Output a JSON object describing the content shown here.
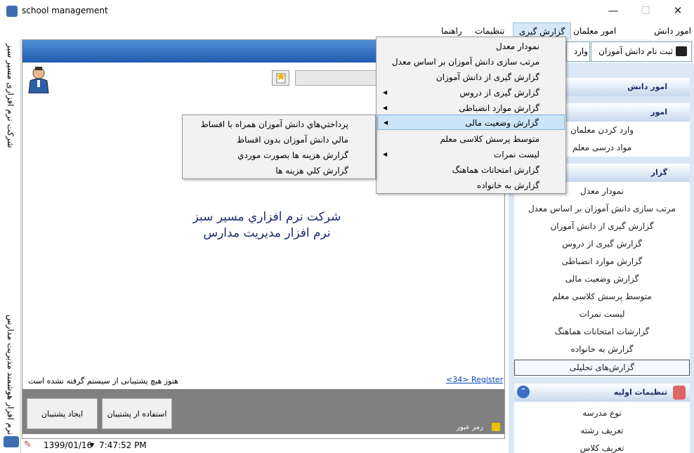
{
  "window": {
    "title": "school management",
    "minimize": "—",
    "maximize": "☐",
    "close": "✕"
  },
  "menubar": [
    {
      "label": "امور دانش آموزان"
    },
    {
      "label": "امور معلمان"
    },
    {
      "label": "گزارش گیری"
    },
    {
      "label": "تنظیمات"
    },
    {
      "label": "راهنما"
    }
  ],
  "left_strip": {
    "top_text": "شرکت نرم افزاری مسیر سبز",
    "bottom_text": "نرم افزار هوشمند مدیریت مدارس"
  },
  "main": {
    "company_line1": "شركت نرم افزاري مسير سبز",
    "company_line2": "نرم افزار مديريت مدارس",
    "register_link": "<34> Register",
    "support_message": "هنوز هیچ پشتیبانی از سیستم گرفته نشده است",
    "create_backup": "ایجاد پشتیبان",
    "use_backup": "استفاده از پشتیبان",
    "password_label": "رمز عبور"
  },
  "statusbar": {
    "date": "1399/01/16",
    "time": "7:47:52 PM"
  },
  "top_buttons": {
    "register_student": "ثبت نام دانش آموزان",
    "enter_teacher": "وارد ك"
  },
  "right_panel": {
    "section1": {
      "title": "امور دانش"
    },
    "section2": {
      "title": "امور",
      "items": [
        "وارد کردن معلمان",
        "مواد درسی معلم"
      ]
    },
    "section3": {
      "title": "گزار",
      "items": [
        "نمودار معدل",
        "مرتب سازی دانش آموزان بر اساس معدل",
        "گزارش گیری از دانش آموزان",
        "گزارش گیری از دروس",
        "گزارش موارد انضباطی",
        "گزارش وضعیت مالی",
        "متوسط پرسش کلاسی معلم",
        "لیست نمرات",
        "گزارشات امتحانات هماهنگ",
        "گزارش به خانواده",
        "گزارش‌های تحلیلی"
      ]
    },
    "section4": {
      "title": "تنظیمات اولیه",
      "items": [
        "نوع مدرسه",
        "تعریف رشته",
        "تعریف کلاس"
      ]
    }
  },
  "dropdown": {
    "items": [
      {
        "label": "نمودار معدل",
        "has_submenu": false
      },
      {
        "label": "مرتب سازی دانش آموزان بر اساس معدل",
        "has_submenu": false
      },
      {
        "label": "گزارش گیری از دانش آموزان",
        "has_submenu": false
      },
      {
        "label": "گزارش گیری از دروس",
        "has_submenu": true
      },
      {
        "label": "گزارش موارد انضباطی",
        "has_submenu": true
      },
      {
        "label": "گزارش وضعیت مالی",
        "has_submenu": true
      },
      {
        "label": "متوسط پرسش کلاسی معلم",
        "has_submenu": false
      },
      {
        "label": "لیست نمرات",
        "has_submenu": true
      },
      {
        "label": "گزارش امتحانات هماهنگ",
        "has_submenu": false
      },
      {
        "label": "گزارش به خانواده",
        "has_submenu": false
      }
    ],
    "submenu": [
      "پرداختي‌هاي دانش آموزان همراه با اقساط",
      "مالي دانش آموزان بدون اقساط",
      "گزارش هزينه ها بصورت موردي",
      "گزارش كلي هزينه ها"
    ]
  }
}
